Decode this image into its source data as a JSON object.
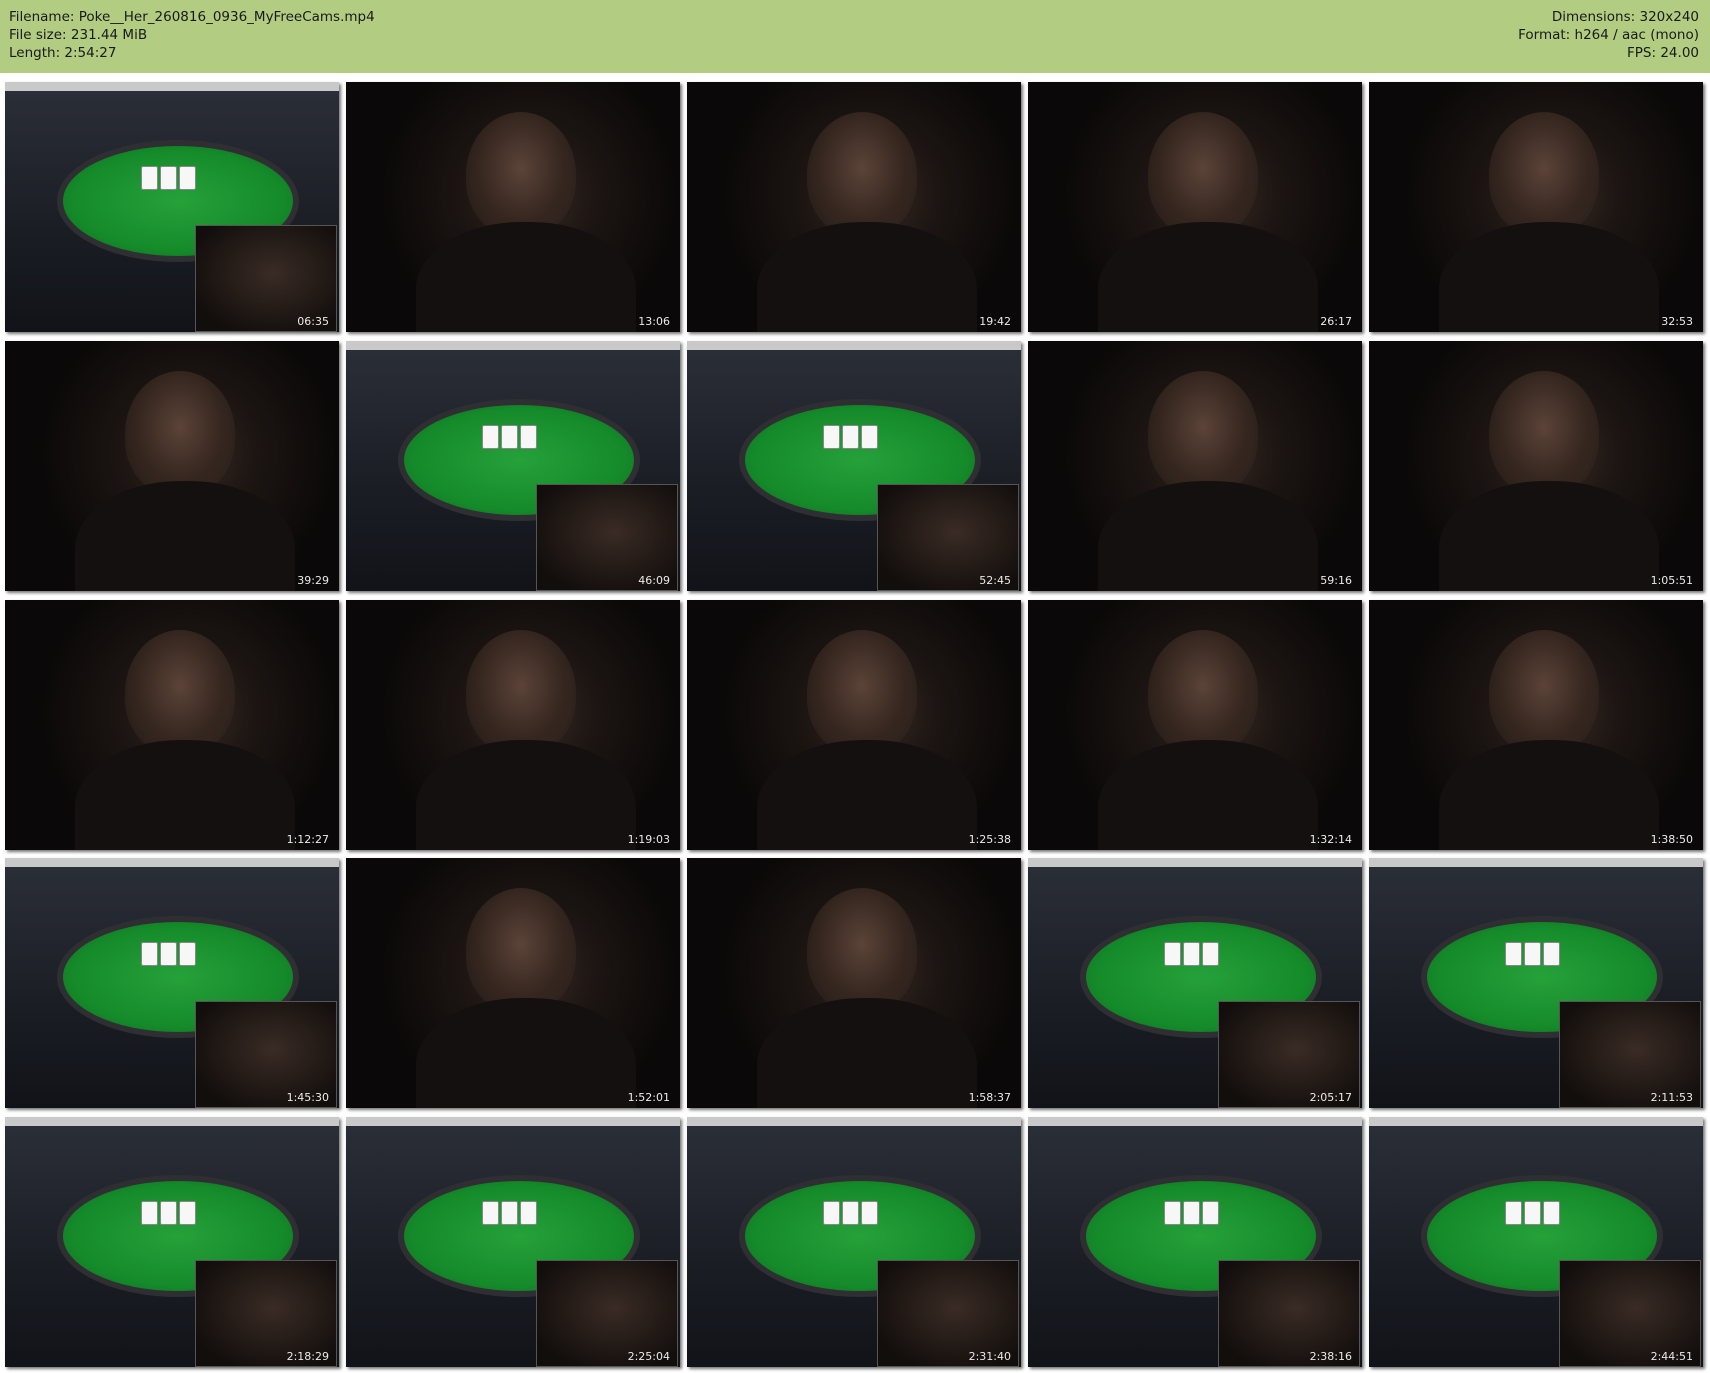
{
  "header": {
    "filename": "Filename: Poke__Her_260816_0936_MyFreeCams.mp4",
    "filesize": "File size: 231.44 MiB",
    "length": "Length: 2:54:27",
    "dimensions": "Dimensions: 320x240",
    "format": "Format: h264 / aac (mono)",
    "fps": "FPS: 24.00",
    "bg_color": "#b2cc82"
  },
  "thumbnails": [
    {
      "time": "06:35",
      "kind": "poker"
    },
    {
      "time": "13:06",
      "kind": "webcam"
    },
    {
      "time": "19:42",
      "kind": "webcam"
    },
    {
      "time": "26:17",
      "kind": "webcam"
    },
    {
      "time": "32:53",
      "kind": "webcam"
    },
    {
      "time": "39:29",
      "kind": "webcam"
    },
    {
      "time": "46:09",
      "kind": "poker"
    },
    {
      "time": "52:45",
      "kind": "poker"
    },
    {
      "time": "59:16",
      "kind": "webcam"
    },
    {
      "time": "1:05:51",
      "kind": "webcam"
    },
    {
      "time": "1:12:27",
      "kind": "webcam"
    },
    {
      "time": "1:19:03",
      "kind": "webcam"
    },
    {
      "time": "1:25:38",
      "kind": "webcam"
    },
    {
      "time": "1:32:14",
      "kind": "webcam"
    },
    {
      "time": "1:38:50",
      "kind": "webcam"
    },
    {
      "time": "1:45:30",
      "kind": "poker"
    },
    {
      "time": "1:52:01",
      "kind": "webcam"
    },
    {
      "time": "1:58:37",
      "kind": "webcam"
    },
    {
      "time": "2:05:17",
      "kind": "poker"
    },
    {
      "time": "2:11:53",
      "kind": "poker"
    },
    {
      "time": "2:18:29",
      "kind": "poker"
    },
    {
      "time": "2:25:04",
      "kind": "poker"
    },
    {
      "time": "2:31:40",
      "kind": "poker"
    },
    {
      "time": "2:38:16",
      "kind": "poker"
    },
    {
      "time": "2:44:51",
      "kind": "poker"
    }
  ]
}
